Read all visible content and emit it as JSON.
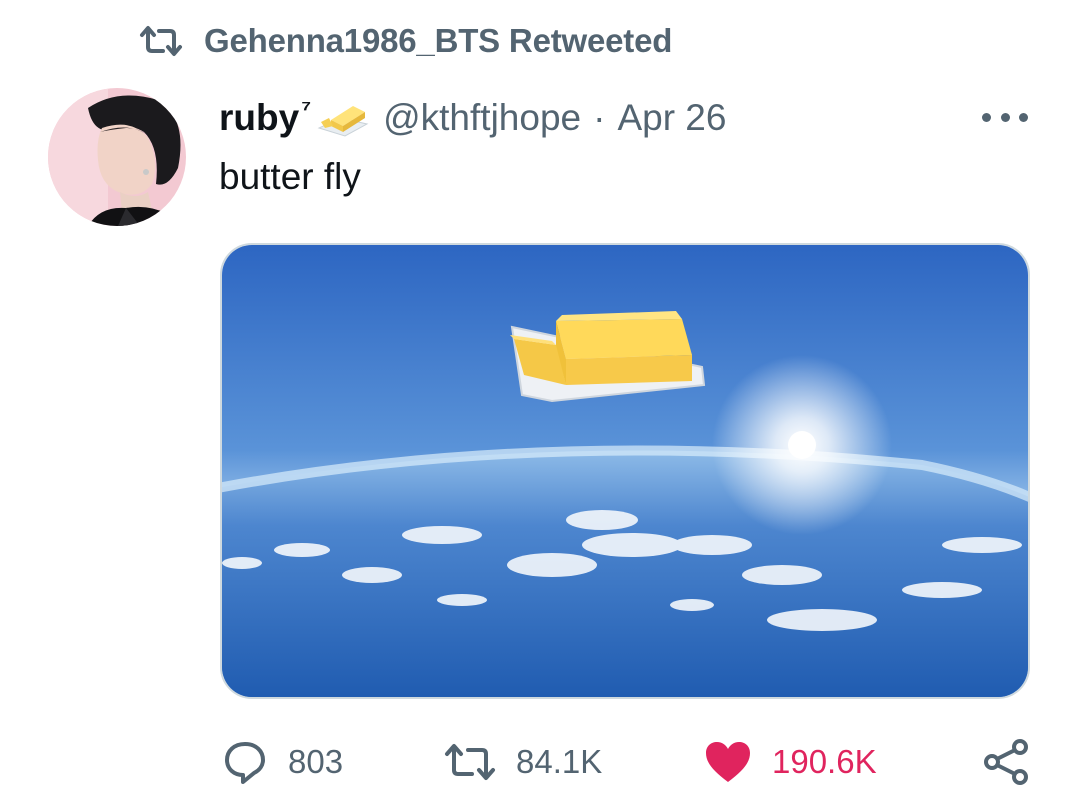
{
  "retweet_banner": {
    "label": "Gehenna1986_BTS Retweeted",
    "icon": "retweet-icon"
  },
  "tweet": {
    "author": {
      "name": "ruby",
      "name_suffix": "⁷",
      "badge_icon": "butter-emoji-icon",
      "handle": "@kthftjhope",
      "avatar_icon": "avatar-photo"
    },
    "separator": "·",
    "date": "Apr 26",
    "text": "butter fly",
    "media": {
      "description_icon": "butter-over-earth-image"
    }
  },
  "actions": {
    "reply": {
      "icon": "reply-bubble-icon",
      "count": "803"
    },
    "retweet": {
      "icon": "retweet-icon",
      "count": "84.1K"
    },
    "like": {
      "icon": "heart-filled-icon",
      "count": "190.6K",
      "liked": true
    },
    "share": {
      "icon": "share-icon"
    }
  },
  "colors": {
    "text_primary": "#0f1419",
    "text_secondary": "#536471",
    "like_red": "#e0245e",
    "border": "#cfd9de"
  }
}
